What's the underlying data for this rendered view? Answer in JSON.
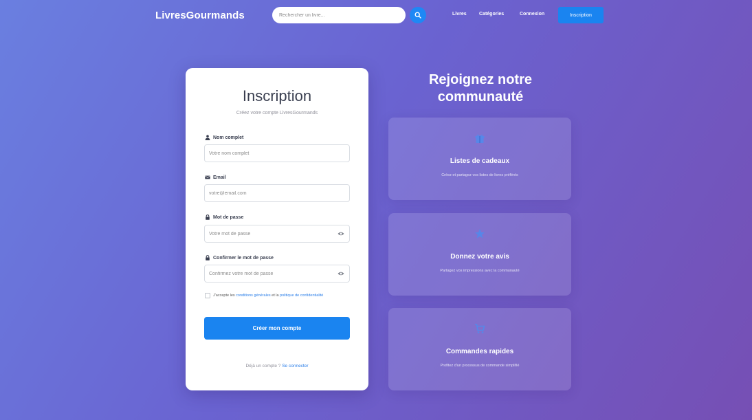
{
  "navbar": {
    "brand": "LivresGourmands",
    "search_placeholder": "Rechercher un livre...",
    "links": [
      "Livres",
      "Catégories",
      "Connexion"
    ],
    "signup_button": "Inscription",
    "accent_color": "#1a84f0"
  },
  "form": {
    "title": "Inscription",
    "subtitle": "Créez votre compte LivresGourmands",
    "fields": [
      {
        "label": "Nom complet",
        "placeholder": "Votre nom complet",
        "icon": "user-icon"
      },
      {
        "label": "Email",
        "placeholder": "votre@email.com",
        "icon": "envelope-icon"
      },
      {
        "label": "Mot de passe",
        "placeholder": "Votre mot de passe",
        "icon": "lock-icon"
      },
      {
        "label": "Confirmer le mot de passe",
        "placeholder": "Confirmez votre mot de passe",
        "icon": "lock-icon"
      }
    ],
    "terms": {
      "prefix": "J'accepte les ",
      "link1": "conditions générales",
      "middle": " et la ",
      "link2": "politique de confidentialité"
    },
    "submit": "Créer mon compte",
    "login_prompt": "Déjà un compte ? ",
    "login_link": "Se connecter"
  },
  "community": {
    "title_line1": "Rejoignez notre",
    "title_line2": "communauté",
    "features": [
      {
        "title": "Listes de cadeaux",
        "desc": "Créez et partagez vos listes de livres préférés",
        "icon": "gift-icon"
      },
      {
        "title": "Donnez votre avis",
        "desc": "Partagez vos impressions avec la communauté",
        "icon": "star-icon"
      },
      {
        "title": "Commandes rapides",
        "desc": "Profitez d'un processus de commande simplifié",
        "icon": "cart-icon"
      }
    ]
  }
}
